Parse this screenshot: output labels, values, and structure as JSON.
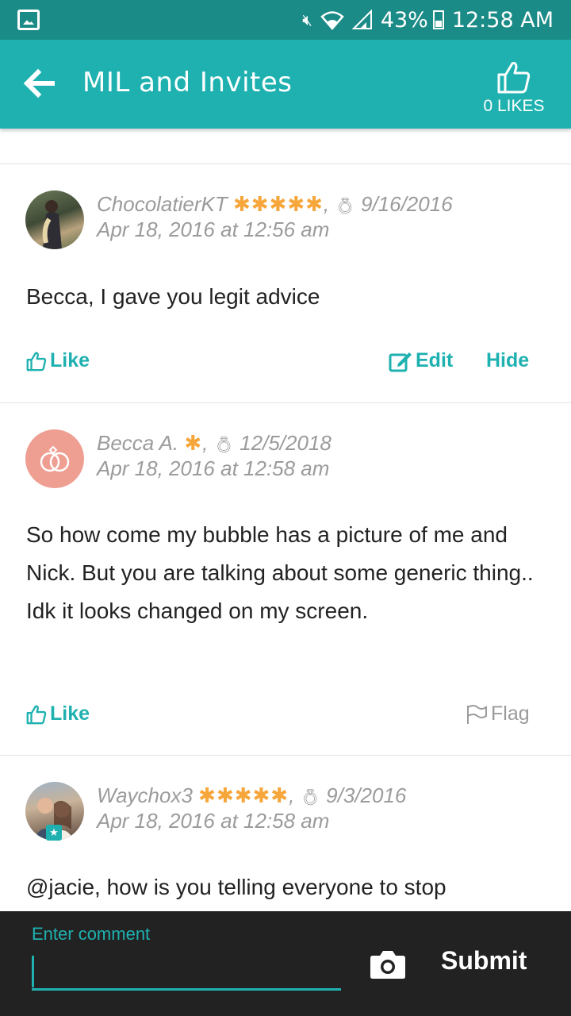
{
  "status_bar": {
    "battery": "43%",
    "time": "12:58 AM",
    "icons": [
      "gallery-icon",
      "mute-icon",
      "wifi-icon",
      "signal-icon",
      "battery-icon"
    ]
  },
  "header": {
    "title": "MIL and Invites",
    "likes_label": "0 LIKES"
  },
  "comments": [
    {
      "author": "ChocolatierKT",
      "stars": "✱✱✱✱✱",
      "wedding_date": "9/16/2016",
      "timestamp": "Apr 18, 2016 at 12:56 am",
      "text": "Becca, I gave you legit advice",
      "like_label": "Like",
      "edit_label": "Edit",
      "hide_label": "Hide"
    },
    {
      "author": "Becca A.",
      "stars": "✱",
      "wedding_date": "12/5/2018",
      "timestamp": "Apr 18, 2016 at 12:58 am",
      "text": "So how come my bubble has a picture of me and Nick. But you are talking about some generic thing.. Idk it looks changed on my screen.",
      "like_label": "Like",
      "flag_label": "Flag"
    },
    {
      "author": "Waychox3",
      "stars": "✱✱✱✱✱",
      "wedding_date": "9/3/2016",
      "timestamp": "Apr 18, 2016 at 12:58 am",
      "text": "@jacie, how is you telling everyone to stop"
    }
  ],
  "composer": {
    "label": "Enter comment",
    "value": "",
    "submit_label": "Submit"
  },
  "colors": {
    "teal": "#1fb1b0",
    "status_bar": "#1b8b88",
    "star_orange": "#f6a63b",
    "avatar_pink": "#ef9e92",
    "bottom_bar": "#222222"
  }
}
